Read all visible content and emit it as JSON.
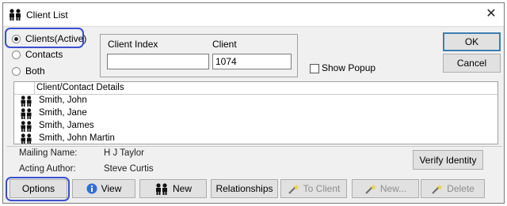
{
  "window": {
    "title": "Client List",
    "close_glyph": "✕"
  },
  "search": {
    "radios": [
      {
        "label": "Clients(Active)",
        "selected": true
      },
      {
        "label": "Contacts",
        "selected": false
      },
      {
        "label": "Both",
        "selected": false
      }
    ],
    "client_index_label": "Client Index",
    "client_index_value": "",
    "client_label": "Client",
    "client_value": "1074",
    "show_popup_label": "Show Popup",
    "show_popup_checked": false
  },
  "dialog_buttons": {
    "ok": "OK",
    "cancel": "Cancel"
  },
  "list": {
    "column_header": "Client/Contact Details",
    "rows": [
      "Smith, John",
      "Smith, Jane",
      "Smith, James",
      "Smith, John Martin"
    ]
  },
  "details": {
    "mailing_name_label": "Mailing Name:",
    "mailing_name_value": "H J Taylor",
    "acting_author_label": "Acting Author:",
    "acting_author_value": "Steve Curtis",
    "verify_identity": "Verify Identity"
  },
  "toolbar": {
    "options": "Options",
    "view": "View",
    "new": "New",
    "relationships": "Relationships",
    "to_client": "To Client",
    "new_link": "New...",
    "delete": "Delete"
  },
  "icons": {
    "people": "people-icon",
    "info": "info-icon",
    "wand": "wand-icon"
  },
  "colors": {
    "highlight": "#3a4fd0",
    "default_button_border": "#3c7fb1",
    "disabled_text": "#8d8d8d"
  }
}
